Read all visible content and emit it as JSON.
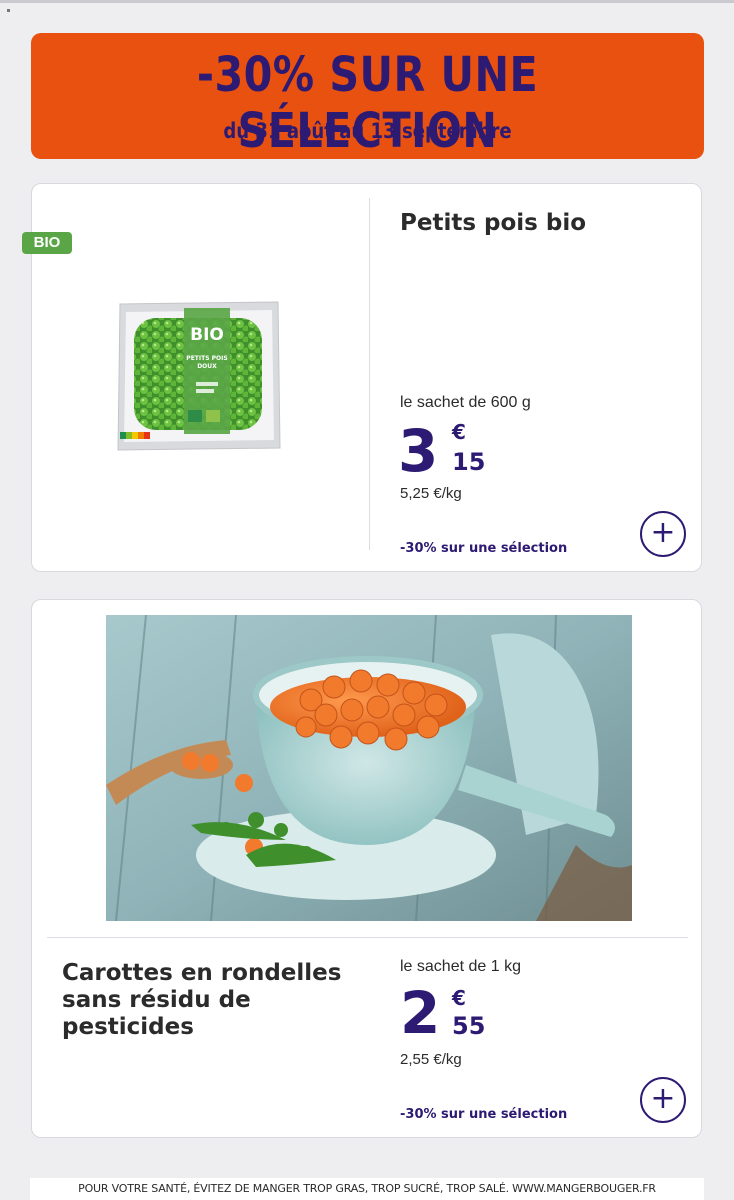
{
  "banner": {
    "title": "-30% SUR UNE SÉLECTION",
    "subtitle": "du 31 août au 13 septembre"
  },
  "products": [
    {
      "badge": "BIO",
      "name": "Petits pois bio",
      "unit": "le sachet de 600 g",
      "price_int": "3",
      "price_currency": "€",
      "price_cents": "15",
      "price_per_kg": "5,25 €/kg",
      "promo": "-30% sur une sélection",
      "add_label": "+",
      "pack_text": {
        "brand": "BIO",
        "line1": "PETITS POIS",
        "line2": "DOUX"
      }
    },
    {
      "name": "Carottes en rondelles sans résidu de pesticides",
      "unit": "le sachet de 1 kg",
      "price_int": "2",
      "price_currency": "€",
      "price_cents": "55",
      "price_per_kg": "2,55 €/kg",
      "promo": "-30% sur une sélection",
      "add_label": "+"
    }
  ],
  "footer": {
    "text": "POUR VOTRE SANTÉ, ÉVITEZ DE MANGER TROP GRAS, TROP SUCRÉ, TROP SALÉ. WWW.MANGERBOUGER.FR"
  },
  "colors": {
    "banner_bg": "#e8510f",
    "brand_navy": "#2d1a73",
    "bio_green": "#5aa646"
  },
  "icons": {
    "add": "plus-icon"
  }
}
